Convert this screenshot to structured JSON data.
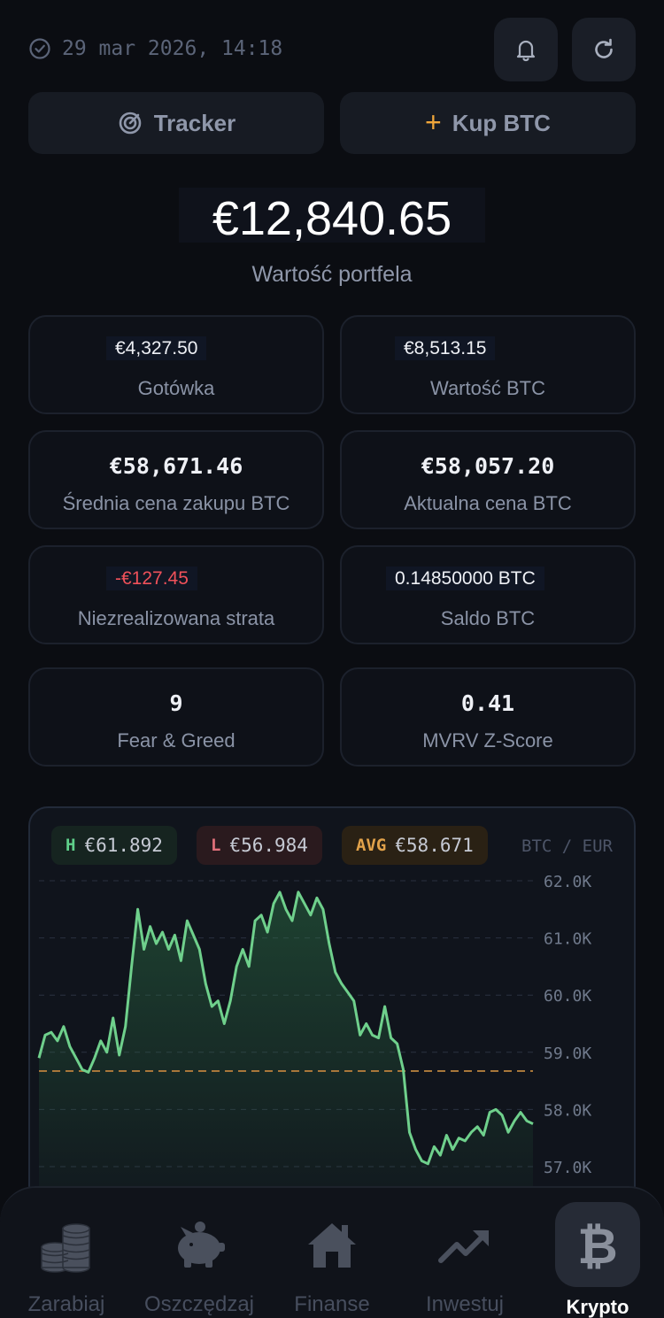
{
  "header": {
    "timestamp": "29 mar 2026, 14:18",
    "icons": {
      "clock": "clock-icon",
      "bell": "bell-icon",
      "refresh": "refresh-icon"
    }
  },
  "actions": {
    "tracker_label": "Tracker",
    "buy_label": "Kup BTC",
    "buy_plus": "+"
  },
  "portfolio": {
    "value": "€12,840.65",
    "label": "Wartość portfela"
  },
  "cards": [
    {
      "value": "€4,327.50",
      "label": "Gotówka"
    },
    {
      "value": "€8,513.15",
      "label": "Wartość BTC"
    },
    {
      "value": "€58,671.46",
      "label": "Średnia cena zakupu BTC"
    },
    {
      "value": "€58,057.20",
      "label": "Aktualna cena BTC"
    },
    {
      "value": "-€127.45",
      "label": "Niezrealizowana strata"
    },
    {
      "value": "0.14850000 BTC",
      "label": "Saldo BTC"
    },
    {
      "value": "9",
      "label": "Fear & Greed"
    },
    {
      "value": "0.41",
      "label": "MVRV Z-Score"
    }
  ],
  "colors": {
    "accent_orange": "#f0a63a",
    "positive": "#6fd08c",
    "negative": "#f0515a",
    "background": "#0b0d12"
  },
  "chart_data": {
    "type": "area",
    "pair": "BTC / EUR",
    "high": {
      "key": "H",
      "value": "€61.892"
    },
    "low": {
      "key": "L",
      "value": "€56.984"
    },
    "avg": {
      "key": "AVG",
      "value": "€58.671"
    },
    "ylim": [
      57000,
      62000
    ],
    "y_ticks": [
      "62.0K",
      "61.0K",
      "60.0K",
      "59.0K",
      "58.0K",
      "57.0K"
    ],
    "y_tick_values": [
      62000,
      61000,
      60000,
      59000,
      58000,
      57000
    ],
    "avg_line": 58671,
    "grid": true,
    "values": [
      58900,
      59300,
      59350,
      59200,
      59450,
      59100,
      58900,
      58700,
      58650,
      58900,
      59200,
      59000,
      59600,
      58950,
      59450,
      60500,
      61500,
      60800,
      61200,
      60900,
      61100,
      60800,
      61050,
      60600,
      61300,
      61050,
      60800,
      60200,
      59800,
      59900,
      59500,
      59900,
      60500,
      60800,
      60500,
      61300,
      61400,
      61100,
      61600,
      61800,
      61500,
      61300,
      61800,
      61600,
      61400,
      61700,
      61500,
      60900,
      60400,
      60200,
      60050,
      59900,
      59300,
      59500,
      59300,
      59250,
      59800,
      59250,
      59150,
      58700,
      57600,
      57300,
      57100,
      57050,
      57350,
      57200,
      57550,
      57300,
      57500,
      57450,
      57600,
      57700,
      57550,
      57950,
      58000,
      57900,
      57600,
      57800,
      57950,
      57800,
      57750
    ]
  },
  "tabbar": {
    "tabs": [
      {
        "label": "Zarabiaj",
        "icon": "coins-icon"
      },
      {
        "label": "Oszczędzaj",
        "icon": "piggy-bank-icon"
      },
      {
        "label": "Finanse",
        "icon": "home-icon"
      },
      {
        "label": "Inwestuj",
        "icon": "trend-up-icon"
      },
      {
        "label": "Krypto",
        "icon": "bitcoin-icon",
        "active": true
      }
    ]
  }
}
